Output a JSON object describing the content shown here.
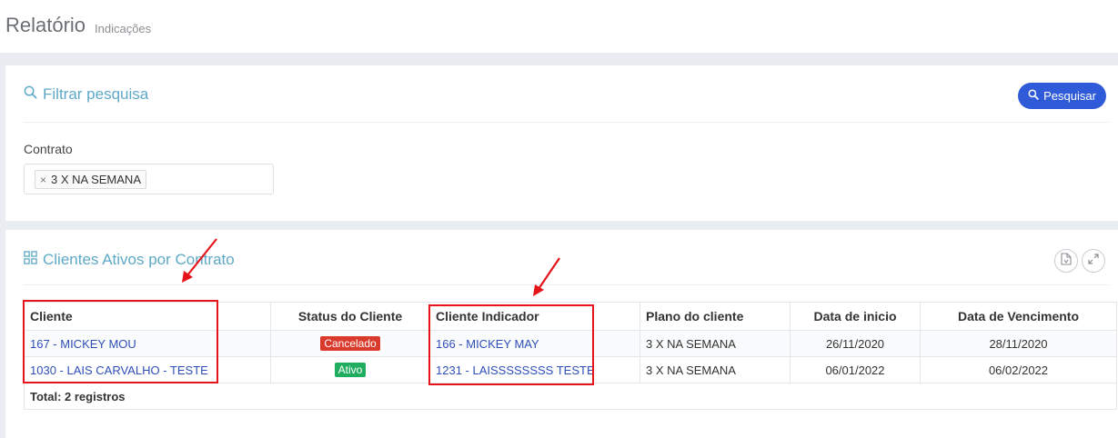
{
  "header": {
    "title": "Relatório",
    "subtitle": "Indicações"
  },
  "filter": {
    "heading": "Filtrar pesquisa",
    "search_button": "Pesquisar",
    "contrato_label": "Contrato",
    "selected_chip": "3 X NA SEMANA",
    "chip_remove": "×"
  },
  "clients_panel": {
    "heading": "Clientes Ativos por Contrato",
    "columns": [
      "Cliente",
      "Status do Cliente",
      "Cliente Indicador",
      "Plano do cliente",
      "Data de inicio",
      "Data de Vencimento"
    ],
    "rows": [
      {
        "cliente": "167 - MICKEY MOU",
        "status": "Cancelado",
        "status_color": "#d93a2b",
        "indicador": "166 - MICKEY MAY",
        "plano": "3 X NA SEMANA",
        "inicio": "26/11/2020",
        "vencimento": "28/11/2020"
      },
      {
        "cliente": "1030 - LAIS CARVALHO - TESTE",
        "status": "Ativo",
        "status_color": "#1fae5f",
        "indicador": "1231 - LAISSSSSSSS TESTE",
        "plano": "3 X NA SEMANA",
        "inicio": "06/01/2022",
        "vencimento": "06/02/2022"
      }
    ],
    "total": "Total: 2 registros"
  },
  "colors": {
    "accent": "#5fa9c8",
    "primary_button": "#2f5bd8",
    "link": "#2f4fb8",
    "annotation": "#e6131a"
  },
  "icons": {
    "filter_heading": "search-icon",
    "clients_heading": "grid-icon",
    "export": "file-export-icon",
    "expand": "expand-icon"
  }
}
